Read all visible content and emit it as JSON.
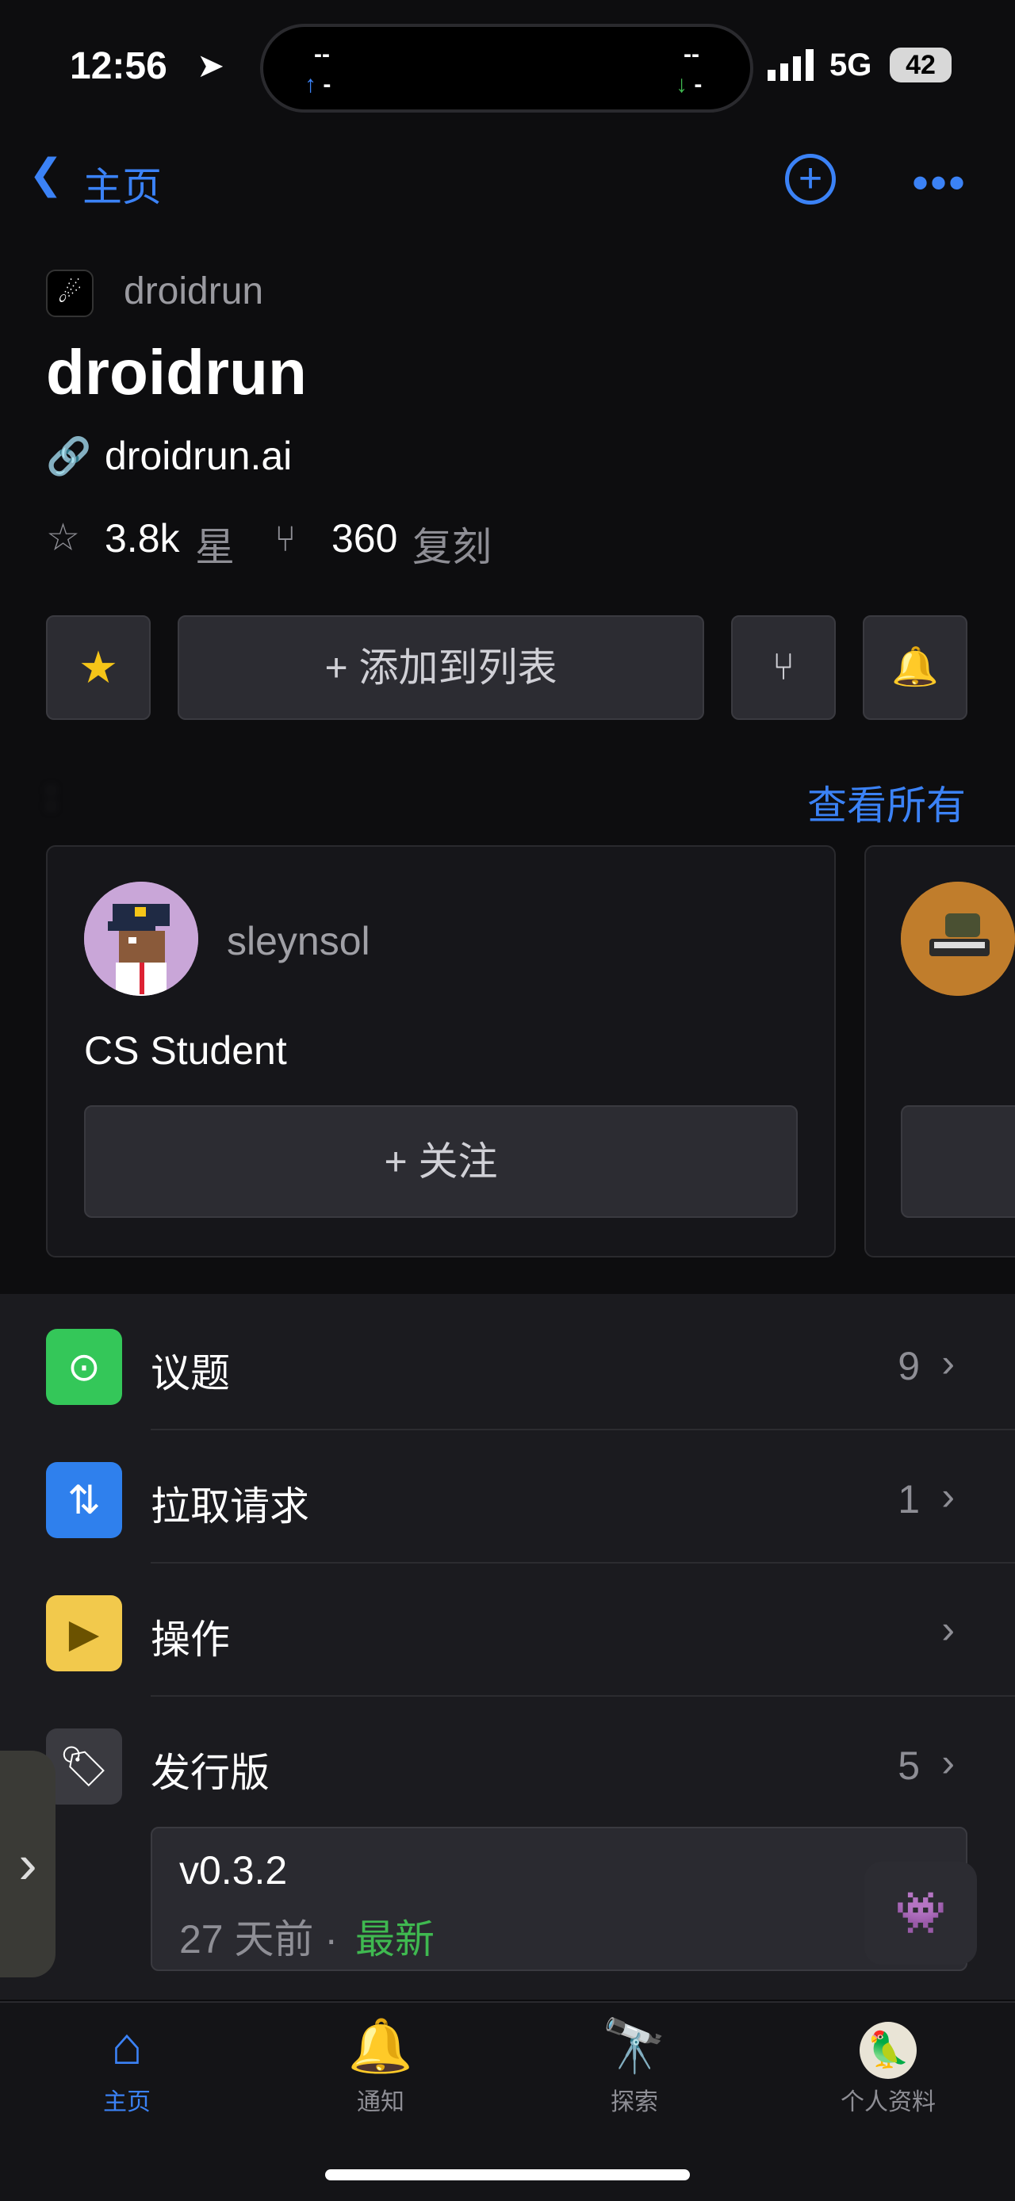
{
  "status": {
    "time": "12:56",
    "island_left_top": "--",
    "island_left_bot": "-",
    "island_right_top": "--",
    "island_right_bot": "-",
    "network": "5G",
    "battery": "42"
  },
  "nav": {
    "back_label": "主页"
  },
  "repo": {
    "owner": "droidrun",
    "name": "droidrun",
    "website": "droidrun.ai",
    "stars": "3.8k",
    "stars_label": "星",
    "forks": "360",
    "forks_label": "复刻"
  },
  "actions": {
    "add_to_list": "+ 添加到列表"
  },
  "contributors": {
    "section_label": ":",
    "view_all": "查看所有",
    "cards": [
      {
        "username": "sleynsol",
        "bio": "CS Student",
        "follow": "+ 关注"
      }
    ]
  },
  "list": {
    "issues": {
      "label": "议题",
      "count": "9"
    },
    "pulls": {
      "label": "拉取请求",
      "count": "1"
    },
    "actions": {
      "label": "操作"
    },
    "releases": {
      "label": "发行版",
      "count": "5"
    }
  },
  "release": {
    "version": "v0.3.2",
    "date": "27 天前 ·",
    "badge": "最新"
  },
  "tabs": {
    "home": "主页",
    "notifications": "通知",
    "explore": "探索",
    "profile": "个人资料"
  },
  "colors": {
    "accent": "#3b82f6",
    "issues": "#34c759",
    "pulls": "#2f80ed",
    "actions": "#f2c94c",
    "releases": "#3a3a40",
    "latest": "#3fb950"
  },
  "icons": {
    "back": "chevron-left-icon",
    "add": "plus-circle-icon",
    "more": "ellipsis-icon",
    "star": "star-icon",
    "fork": "fork-icon",
    "bell": "bell-icon",
    "copilot": "copilot-icon"
  }
}
